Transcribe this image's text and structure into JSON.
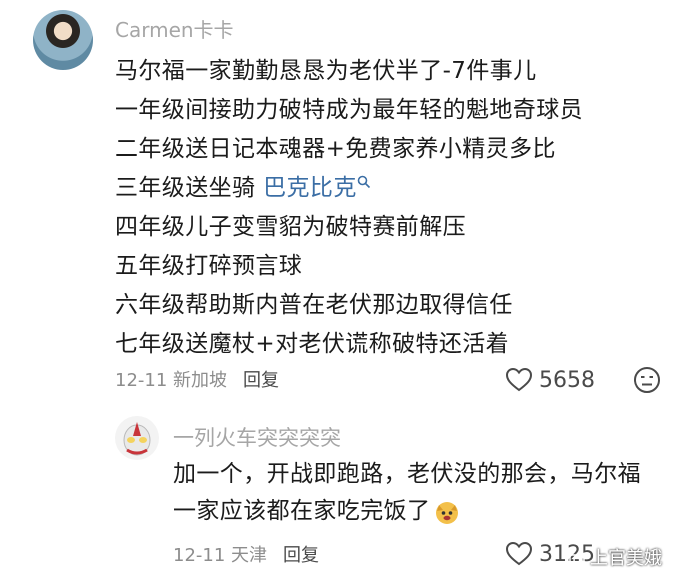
{
  "comment": {
    "username": "Carmen卡卡",
    "lines": [
      "马尔福一家勤勤恳恳为老伏半了-7件事儿",
      "一年级间接助力破特成为最年轻的魁地奇球员",
      "二年级送日记本魂器+免费家养小精灵多比",
      "三年级送坐骑",
      "四年级儿子变雪貂为破特赛前解压",
      "五年级打碎预言球",
      "六年级帮助斯内普在老伏那边取得信任",
      "七年级送魔杖+对老伏谎称破特还活着"
    ],
    "link_text": "巴克比克",
    "date": "12-11",
    "location": "新加坡",
    "reply_label": "回复",
    "likes": "5658"
  },
  "reply": {
    "username": "一列火车突突突突",
    "lines": [
      "加一个，开战即跑路，老伏没的那会，马尔福",
      "一家应该都在家吃完饭了"
    ],
    "date": "12-11",
    "location": "天津",
    "reply_label": "回复",
    "likes": "3125"
  },
  "watermark": "上官美娥",
  "colors": {
    "link": "#3b6ea5",
    "muted": "#a6a6a6"
  }
}
